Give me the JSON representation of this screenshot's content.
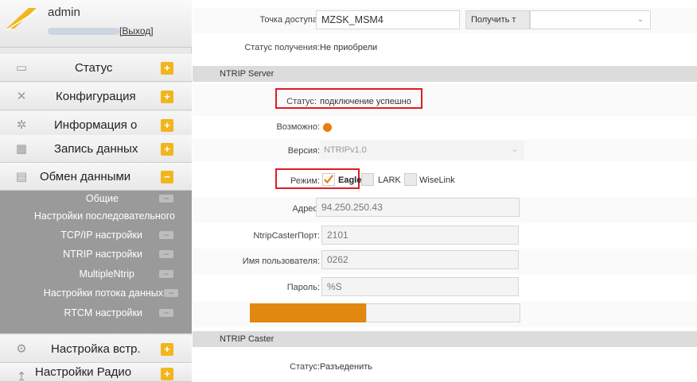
{
  "sidebar": {
    "user": {
      "name": "admin",
      "logout": "[Выход]"
    },
    "items": [
      {
        "label": "Статус",
        "icon": "monitor-icon"
      },
      {
        "label": "Конфигурация",
        "icon": "tools-icon"
      },
      {
        "label": "Информация о",
        "icon": "satellite-icon"
      },
      {
        "label": "Запись данных",
        "icon": "calendar-icon"
      },
      {
        "label": "Обмен данными",
        "icon": "document-icon"
      },
      {
        "label": "Настройка встр.",
        "icon": "gear-icon"
      },
      {
        "label": "Настройки Радио",
        "icon": "antenna-icon"
      }
    ],
    "submenu": [
      "Общие",
      "Настройки последовательного",
      "TCP/IP настройки",
      "NTRIP настройки",
      "MultipleNtrip",
      "Настройки потока данных",
      "RTCM настройки"
    ]
  },
  "main": {
    "access_point": {
      "label": "Точка доступа",
      "value": "MZSK_MSM4",
      "button": "Получить т"
    },
    "receive_status": {
      "label": "Статус получения",
      "value": "Не приобрели"
    },
    "ntrip_server": {
      "title": "NTRIP Server",
      "status": {
        "label": "Статус",
        "value": "подключение успешно"
      },
      "enabled": {
        "label": "Возможно"
      },
      "version": {
        "label": "Версия",
        "value": "NTRIPv1.0"
      },
      "mode": {
        "label": "Режим",
        "options": [
          "Eagle",
          "LARK",
          "WiseLink"
        ],
        "selected": "Eagle"
      },
      "address": {
        "label": "Адрес",
        "value": "94.250.250.43"
      },
      "port": {
        "label": "NtripCasterПорт",
        "value": "2101"
      },
      "username": {
        "label": "Имя пользователя",
        "value": "0262"
      },
      "password": {
        "label": "Пароль",
        "value": "%S"
      }
    },
    "ntrip_caster": {
      "title": "NTRIP Caster",
      "status": {
        "label": "Статус",
        "value": "Разъеденить"
      }
    }
  },
  "colors": {
    "accent": "#f2b51e",
    "orange_bar": "#e0880f",
    "highlight": "#e01b24",
    "submenu_bg": "#9a9a9a"
  }
}
